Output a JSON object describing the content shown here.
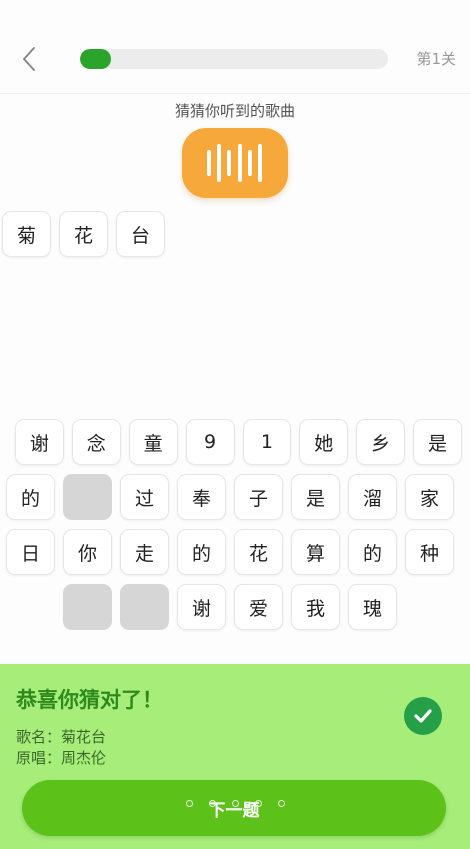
{
  "header": {
    "level_label": "第1关",
    "progress": 0.1
  },
  "prompt": "猜猜你听到的歌曲",
  "answer": [
    "菊",
    "花",
    "台"
  ],
  "grid": {
    "row1": [
      "谢",
      "念",
      "童",
      "9",
      "1",
      "她",
      "乡",
      "是"
    ],
    "row2": [
      "的",
      "",
      "过",
      "奉",
      "子",
      "是",
      "溜",
      "家"
    ],
    "row3": [
      "日",
      "你",
      "走",
      "的",
      "花",
      "算",
      "的",
      "种"
    ],
    "row4": [
      "",
      "",
      "谢",
      "爱",
      "我",
      "瑰"
    ]
  },
  "result": {
    "title": "恭喜你猜对了！",
    "song": "歌名：菊花台",
    "singer": "原唱：周杰伦",
    "next_label": "下一题"
  },
  "colors": {
    "accent": "#2aa52a",
    "play": "#f7a83a",
    "panel": "#a7ed7a",
    "next": "#5cc21a"
  },
  "icons": {
    "back": "chevron-left-icon",
    "play": "sound-wave-icon",
    "check": "check-circle-icon"
  }
}
